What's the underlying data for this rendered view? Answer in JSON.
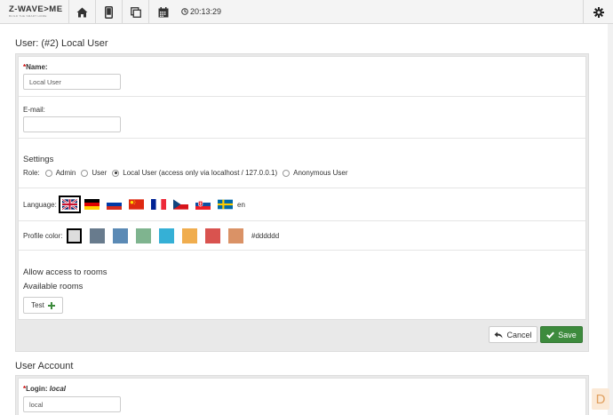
{
  "topbar": {
    "logo_text": "Z-WAVE>ME",
    "logo_sub": "BUILD THE SMART HOME",
    "clock": "20:13:29",
    "icons": [
      "home-icon",
      "mobile-icon",
      "copy-icon",
      "calendar-icon",
      "clock-icon",
      "gear-icon"
    ]
  },
  "user": {
    "title": "User: (#2) Local User",
    "name_label": "Name:",
    "name_value": "Local User",
    "email_label": "E-mail:",
    "email_value": "",
    "settings_heading": "Settings",
    "role_label": "Role:",
    "roles": [
      {
        "label": "Admin",
        "selected": false
      },
      {
        "label": "User",
        "selected": false
      },
      {
        "label": "Local User (access only via localhost / 127.0.0.1)",
        "selected": true
      },
      {
        "label": "Anonymous User",
        "selected": false
      }
    ],
    "language_label": "Language:",
    "languages": [
      "en",
      "de",
      "ru",
      "cn",
      "fr",
      "cz",
      "sk",
      "sv"
    ],
    "selected_language": "en",
    "profile_color_label": "Profile color:",
    "colors": [
      "#dddddd",
      "#687b8d",
      "#5b8ab5",
      "#7fb48f",
      "#35b0d6",
      "#f0ad4e",
      "#d9534f",
      "#da9266"
    ],
    "selected_color": "#dddddd",
    "rooms_heading": "Allow access to rooms",
    "rooms_subheading": "Available rooms",
    "rooms": [
      "Test"
    ],
    "cancel_label": "Cancel",
    "save_label": "Save"
  },
  "account": {
    "title": "User Account",
    "login_label": "Login:",
    "login_name": "local",
    "login_value": "local"
  },
  "colors": {
    "accent": "#3d8b3d",
    "required": "#cc0000"
  }
}
